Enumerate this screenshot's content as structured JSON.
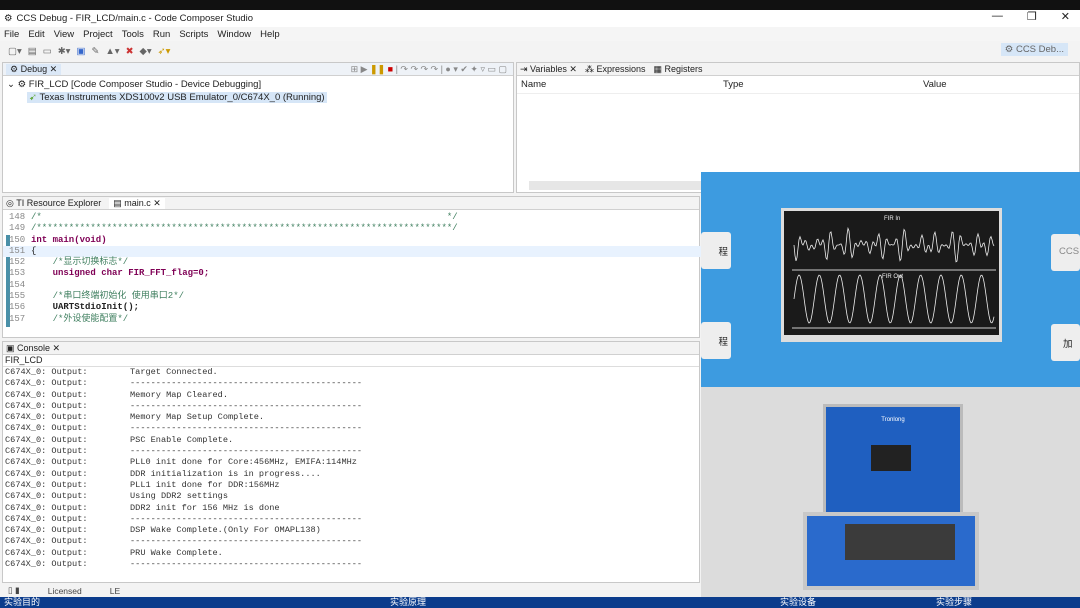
{
  "window": {
    "title": "CCS Debug - FIR_LCD/main.c - Code Composer Studio",
    "controls": [
      "—",
      "❐",
      "✕"
    ]
  },
  "menu": [
    "File",
    "Edit",
    "View",
    "Project",
    "Tools",
    "Run",
    "Scripts",
    "Window",
    "Help"
  ],
  "perspective": {
    "label": "CCS Deb..."
  },
  "debug": {
    "tab": "Debug",
    "tree": [
      {
        "label": "FIR_LCD [Code Composer Studio - Device Debugging]"
      },
      {
        "label": "Texas Instruments XDS100v2 USB Emulator_0/C674X_0 (Running)"
      }
    ]
  },
  "variables": {
    "tabs": [
      "Variables",
      "Expressions",
      "Registers"
    ],
    "columns": [
      "Name",
      "Type",
      "Value"
    ]
  },
  "editor": {
    "tabs": [
      "TI Resource Explorer",
      "main.c"
    ],
    "lines": [
      {
        "n": "148",
        "t": "/*                                                                           */"
      },
      {
        "n": "149",
        "t": "/*****************************************************************************/"
      },
      {
        "n": "150",
        "t": "int main(void)"
      },
      {
        "n": "151",
        "t": "{"
      },
      {
        "n": "152",
        "t": "    /*显示切换标志*/"
      },
      {
        "n": "153",
        "t": "    unsigned char FIR_FFT_flag=0;"
      },
      {
        "n": "154",
        "t": ""
      },
      {
        "n": "155",
        "t": "    /*串口终端初始化 使用串口2*/"
      },
      {
        "n": "156",
        "t": "    UARTStdioInit();"
      },
      {
        "n": "157",
        "t": "    /*外设使能配置*/"
      }
    ]
  },
  "console": {
    "tab": "Console",
    "project": "FIR_LCD",
    "prefix": "C674X_0: Output:",
    "messages": [
      "Target Connected.",
      "---------------------------------------------",
      "Memory Map Cleared.",
      "---------------------------------------------",
      "Memory Map Setup Complete.",
      "---------------------------------------------",
      "PSC Enable Complete.",
      "---------------------------------------------",
      "PLL0 init done for Core:456MHz, EMIFA:114MHz",
      "DDR initialization is in progress....",
      "PLL1 init done for DDR:156MHz",
      "Using DDR2 settings",
      "DDR2 init for 156 MHz is done",
      "---------------------------------------------",
      "DSP Wake Complete.(Only For OMAPL138)",
      "---------------------------------------------",
      "PRU Wake Complete.",
      "---------------------------------------------"
    ]
  },
  "status": {
    "license": "Licensed",
    "mode": "LE"
  },
  "video": {
    "lcd_top_title": "FIR In",
    "lcd_bottom_title": "FIR Out",
    "side_left": [
      "程",
      "程"
    ],
    "side_right": [
      "CCS",
      "加"
    ],
    "case_brand": "Tronlong"
  },
  "bottom_bar": [
    "实验目的",
    "实验原理",
    "实验设备",
    "实验步骤"
  ],
  "colors": {
    "accent": "#0b3c8c",
    "photo_blue": "#3d9be0"
  }
}
